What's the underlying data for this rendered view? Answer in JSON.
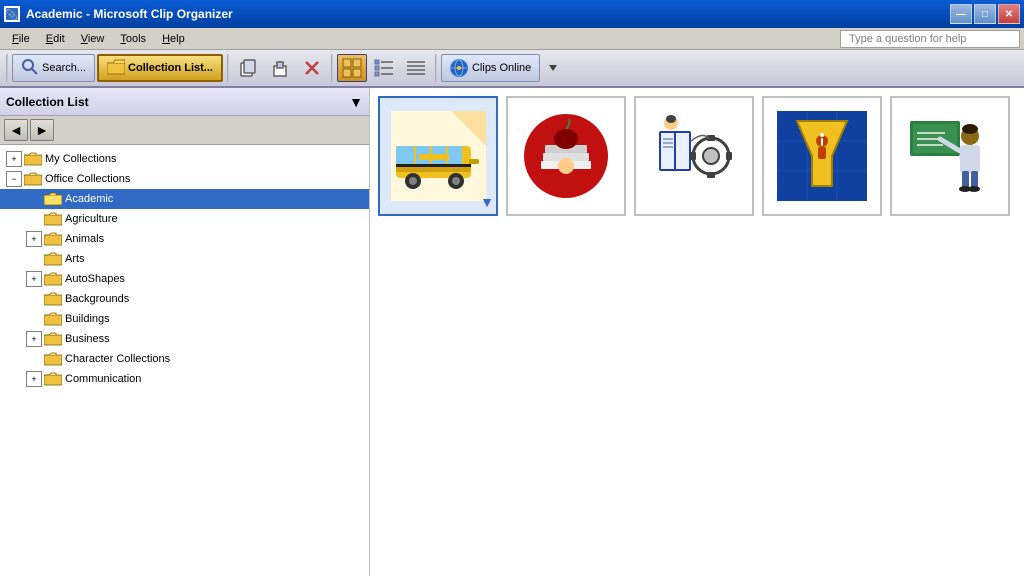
{
  "titleBar": {
    "title": "Academic - Microsoft Clip Organizer",
    "icon": "📎",
    "minimizeLabel": "—",
    "maximizeLabel": "□",
    "closeLabel": "✕"
  },
  "menuBar": {
    "items": [
      {
        "label": "File",
        "underlineIndex": 0
      },
      {
        "label": "Edit",
        "underlineIndex": 0
      },
      {
        "label": "View",
        "underlineIndex": 0
      },
      {
        "label": "Tools",
        "underlineIndex": 0
      },
      {
        "label": "Help",
        "underlineIndex": 0
      }
    ],
    "helpPlaceholder": "Type a question for help"
  },
  "toolbar": {
    "searchLabel": "Search...",
    "collectionListLabel": "Collection List...",
    "clipsOnlineLabel": "Clips Online"
  },
  "sidebar": {
    "title": "Collection List",
    "backLabel": "◄",
    "forwardLabel": "►",
    "tree": [
      {
        "id": "my-collections",
        "label": "My Collections",
        "indent": 0,
        "expandable": true,
        "expanded": false,
        "selected": false
      },
      {
        "id": "office-collections",
        "label": "Office Collections",
        "indent": 0,
        "expandable": true,
        "expanded": true,
        "selected": false
      },
      {
        "id": "academic",
        "label": "Academic",
        "indent": 1,
        "expandable": false,
        "expanded": false,
        "selected": true
      },
      {
        "id": "agriculture",
        "label": "Agriculture",
        "indent": 1,
        "expandable": false,
        "expanded": false,
        "selected": false
      },
      {
        "id": "animals",
        "label": "Animals",
        "indent": 1,
        "expandable": true,
        "expanded": false,
        "selected": false
      },
      {
        "id": "arts",
        "label": "Arts",
        "indent": 1,
        "expandable": false,
        "expanded": false,
        "selected": false
      },
      {
        "id": "autoshapes",
        "label": "AutoShapes",
        "indent": 1,
        "expandable": true,
        "expanded": false,
        "selected": false
      },
      {
        "id": "backgrounds",
        "label": "Backgrounds",
        "indent": 1,
        "expandable": false,
        "expanded": false,
        "selected": false
      },
      {
        "id": "buildings",
        "label": "Buildings",
        "indent": 1,
        "expandable": false,
        "expanded": false,
        "selected": false
      },
      {
        "id": "business",
        "label": "Business",
        "indent": 1,
        "expandable": true,
        "expanded": false,
        "selected": false
      },
      {
        "id": "character-collections",
        "label": "Character Collections",
        "indent": 1,
        "expandable": false,
        "expanded": false,
        "selected": false
      },
      {
        "id": "communication",
        "label": "Communication",
        "indent": 1,
        "expandable": true,
        "expanded": false,
        "selected": false
      }
    ]
  },
  "content": {
    "clips": [
      {
        "id": 1,
        "label": "school-bus",
        "selected": true
      },
      {
        "id": 2,
        "label": "books-apple",
        "selected": false
      },
      {
        "id": 3,
        "label": "book-gears",
        "selected": false
      },
      {
        "id": 4,
        "label": "funnel-info",
        "selected": false
      },
      {
        "id": 5,
        "label": "teacher",
        "selected": false
      }
    ]
  }
}
